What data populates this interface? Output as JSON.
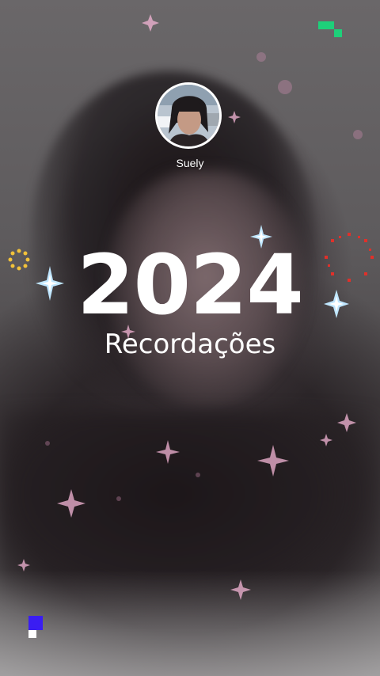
{
  "profile": {
    "username": "Suely"
  },
  "recap": {
    "year": "2024",
    "subtitle": "Recordações"
  },
  "colors": {
    "accent_green": "#1ed07a",
    "accent_blue": "#3a1df2",
    "sparkle_blue": "#bfe6ff",
    "sparkle_gold": "#f2c23a",
    "sparkle_red": "#e0302a",
    "sparkle_pink": "#f4b6d6"
  },
  "icons": [
    "avatar",
    "sparkle-icon",
    "firework-icon",
    "pixel-logo-icon"
  ]
}
